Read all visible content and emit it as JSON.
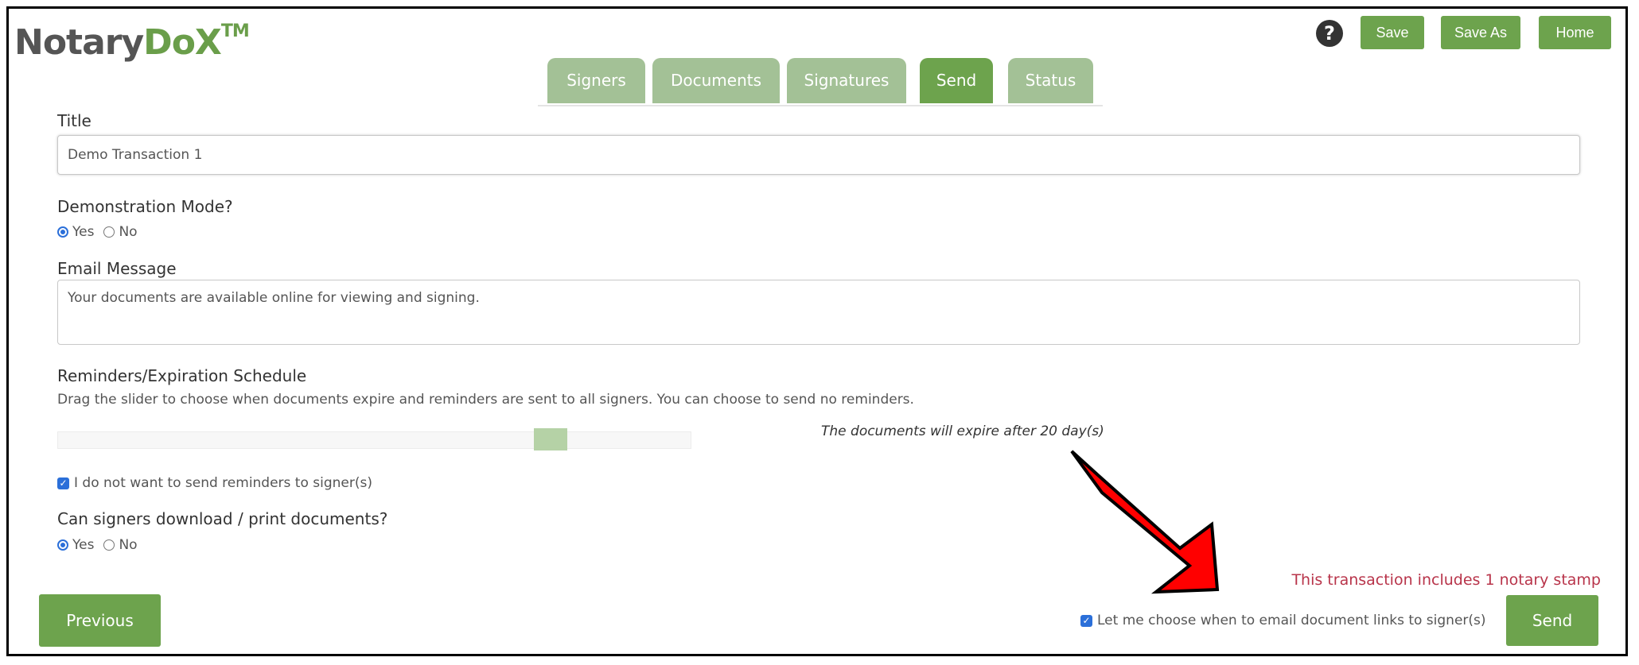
{
  "brand": {
    "name_part1": "Notary",
    "name_part2": "DoX",
    "trademark": "TM"
  },
  "header": {
    "help_icon": "question-circle-icon",
    "save_label": "Save",
    "save_as_label": "Save As",
    "home_label": "Home"
  },
  "tabs": [
    {
      "label": "Signers",
      "active": false
    },
    {
      "label": "Documents",
      "active": false
    },
    {
      "label": "Signatures",
      "active": false
    },
    {
      "label": "Send",
      "active": true
    },
    {
      "label": "Status",
      "active": false
    }
  ],
  "form": {
    "title_label": "Title",
    "title_value": "Demo Transaction 1",
    "demo_mode_label": "Demonstration Mode?",
    "demo_mode_options": [
      "Yes",
      "No"
    ],
    "demo_mode_selected": "Yes",
    "email_message_label": "Email Message",
    "email_message_value": "Your documents are available online for viewing and signing.",
    "schedule_label": "Reminders/Expiration Schedule",
    "schedule_help": "Drag the slider to choose when documents expire and reminders are sent to all signers. You can choose to send no reminders.",
    "schedule_status": "The documents will expire after 20 day(s)",
    "slider_position": 0.81,
    "no_reminders_label": "I do not want to send reminders to signer(s)",
    "no_reminders_checked": true,
    "download_label": "Can signers download / print documents?",
    "download_options": [
      "Yes",
      "No"
    ],
    "download_selected": "Yes"
  },
  "footer": {
    "notary_note": "This transaction includes 1 notary stamp",
    "choose_email_label": "Let me choose when to email document links to signer(s)",
    "choose_email_checked": true,
    "previous_label": "Previous",
    "send_label": "Send"
  },
  "colors": {
    "brand_green": "#6da34d",
    "tab_inactive": "#a3c196",
    "note_red": "#b8344a",
    "arrow_red": "#ff0000"
  }
}
